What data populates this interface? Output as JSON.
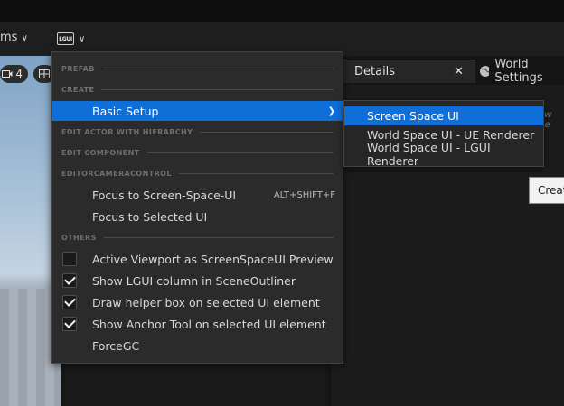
{
  "toolbar": {
    "partial_label": "ms",
    "lgui_logo": "LGUI"
  },
  "viewport": {
    "camera_speed": "4"
  },
  "tabs": {
    "details": "Details",
    "world_settings": "World Settings"
  },
  "right_panel": {
    "partial_hint": "ew de",
    "tooltip_partial": "Creat"
  },
  "menu": {
    "sections": {
      "prefab": "PREFAB",
      "create": "CREATE",
      "edit_actor": "EDIT ACTOR WITH HIERARCHY",
      "edit_component": "EDIT COMPONENT",
      "editor_camera": "EDITORCAMERACONTROL",
      "others": "OTHERS"
    },
    "basic_setup": "Basic Setup",
    "focus_screen_space": {
      "label": "Focus to Screen-Space-UI",
      "shortcut": "ALT+SHIFT+F"
    },
    "focus_selected": "Focus to Selected UI",
    "options": [
      {
        "label": "Active Viewport as ScreenSpaceUI Preview",
        "checked": false
      },
      {
        "label": "Show LGUI column in SceneOutliner",
        "checked": true
      },
      {
        "label": "Draw helper box on selected UI element",
        "checked": true
      },
      {
        "label": "Show Anchor Tool on selected UI element",
        "checked": true
      }
    ],
    "force_gc": "ForceGC"
  },
  "submenu": {
    "items": [
      "Screen Space UI",
      "World Space UI - UE Renderer",
      "World Space UI - LGUI Renderer"
    ],
    "highlighted": "Screen Space UI"
  },
  "colors": {
    "highlight": "#0f6ed8",
    "menu_bg": "#2b2b2b",
    "panel_bg": "#1c1c1c"
  }
}
